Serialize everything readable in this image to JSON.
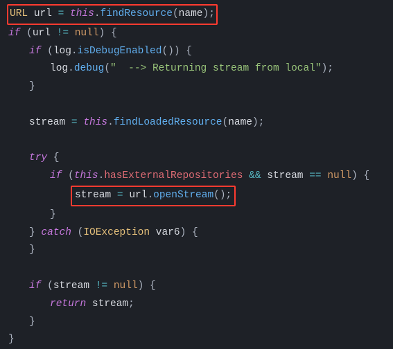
{
  "code": {
    "l1_type": "URL",
    "l1_var": "url",
    "l1_eq": " = ",
    "l1_this": "this",
    "l1_dot": ".",
    "l1_fn": "findResource",
    "l1_arg": "name",
    "l1_end": ";",
    "l2_if": "if",
    "l2_open": " (",
    "l2_var": "url",
    "l2_op": " != ",
    "l2_null": "null",
    "l2_close": ") {",
    "l3_if": "if",
    "l3_open": " (",
    "l3_log": "log",
    "l3_dot": ".",
    "l3_fn": "isDebugEnabled",
    "l3_close": "()) {",
    "l4_log": "log",
    "l4_dot": ".",
    "l4_fn": "debug",
    "l4_open": "(",
    "l4_str": "\"  --> Returning stream from local\"",
    "l4_close": ");",
    "l5_brace": "}",
    "l7_stream": "stream",
    "l7_eq": " = ",
    "l7_this": "this",
    "l7_dot": ".",
    "l7_fn": "findLoadedResource",
    "l7_arg": "name",
    "l7_close": ");",
    "l7_open": "(",
    "l9_try": "try",
    "l9_brace": " {",
    "l10_if": "if",
    "l10_open": " (",
    "l10_this": "this",
    "l10_dot": ".",
    "l10_field": "hasExternalRepositories",
    "l10_and": " && ",
    "l10_stream": "stream",
    "l10_eq": " == ",
    "l10_null": "null",
    "l10_close": ") {",
    "l11_stream": "stream",
    "l11_eq": " = ",
    "l11_url": "url",
    "l11_dot": ".",
    "l11_fn": "openStream",
    "l11_close": "();",
    "l12_brace": "}",
    "l13_brace": "}",
    "l13_catch": " catch",
    "l13_open": " (",
    "l13_type": "IOException",
    "l13_var": " var6",
    "l13_close": ") {",
    "l14_brace": "}",
    "l16_if": "if",
    "l16_open": " (",
    "l16_stream": "stream",
    "l16_op": " != ",
    "l16_null": "null",
    "l16_close": ") {",
    "l17_return": "return",
    "l17_sp": " ",
    "l17_stream": "stream",
    "l17_semi": ";",
    "l18_brace": "}",
    "l19_brace": "}"
  }
}
